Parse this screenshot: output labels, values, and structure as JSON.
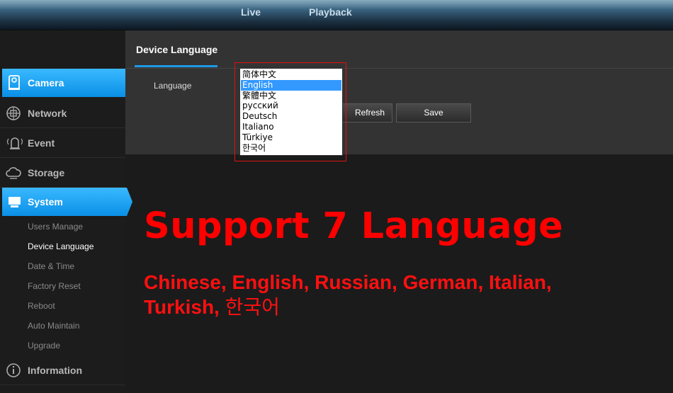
{
  "topnav": {
    "tabs": [
      {
        "label": "Live"
      },
      {
        "label": "Playback"
      }
    ]
  },
  "sidebar": {
    "items": [
      {
        "label": "Camera",
        "icon": "camera-icon",
        "active": true
      },
      {
        "label": "Network",
        "icon": "network-icon"
      },
      {
        "label": "Event",
        "icon": "event-bell-icon"
      },
      {
        "label": "Storage",
        "icon": "cloud-storage-icon"
      },
      {
        "label": "System",
        "icon": "monitor-icon",
        "active": true
      },
      {
        "label": "Information",
        "icon": "info-icon"
      }
    ],
    "system_sub": [
      {
        "label": "Users Manage"
      },
      {
        "label": "Device Language",
        "current": true
      },
      {
        "label": "Date & Time"
      },
      {
        "label": "Factory Reset"
      },
      {
        "label": "Reboot"
      },
      {
        "label": "Auto Maintain"
      },
      {
        "label": "Upgrade"
      }
    ]
  },
  "panel": {
    "title": "Device Language",
    "language_label": "Language",
    "refresh_label": "Refresh",
    "save_label": "Save",
    "selected_language": "English",
    "options": [
      {
        "label": "简体中文"
      },
      {
        "label": "English"
      },
      {
        "label": "繁體中文"
      },
      {
        "label": "русский"
      },
      {
        "label": "Deutsch"
      },
      {
        "label": "Italiano"
      },
      {
        "label": "Türkiye"
      },
      {
        "label": "한국어"
      }
    ]
  },
  "overlay": {
    "headline": "Support 7 Language",
    "line1": "Chinese, English, Russian,  German, Italian,",
    "line2": "Turkish,",
    "line2_korean": "한국어"
  },
  "colors": {
    "accent": "#1f9ae8",
    "active_item": "#1aa3f5",
    "overlay_text": "#ff0000",
    "highlight_frame": "#e01010"
  }
}
